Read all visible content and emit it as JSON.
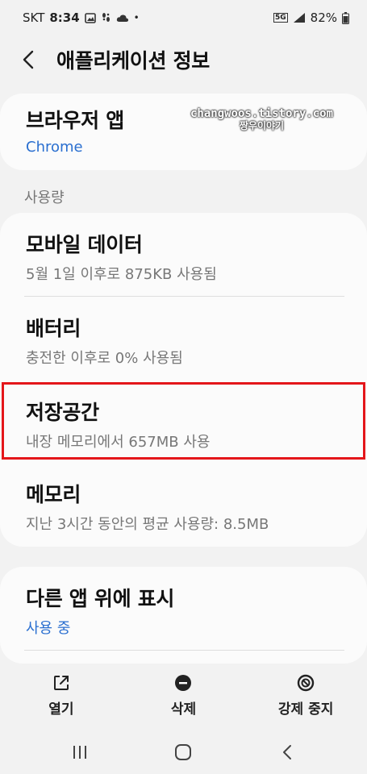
{
  "status_bar": {
    "carrier": "SKT",
    "time": "8:34",
    "dot": "•",
    "network": "5G",
    "battery": "82%"
  },
  "header": {
    "title": "애플리케이션 정보",
    "back_icon": "chevron-left-icon"
  },
  "app_card": {
    "name": "브라우저 앱",
    "app": "Chrome"
  },
  "watermark": {
    "line1": "changwoos.tistory.com",
    "line2": "짱우이야기"
  },
  "usage": {
    "section_label": "사용량",
    "items": [
      {
        "title": "모바일 데이터",
        "subtitle": "5월 1일 이후로 875KB 사용됨"
      },
      {
        "title": "배터리",
        "subtitle": "충전한 이후로 0% 사용됨"
      },
      {
        "title": "저장공간",
        "subtitle": "내장 메모리에서 657MB 사용"
      },
      {
        "title": "메모리",
        "subtitle": "지난 3시간 동안의 평균 사용량: 8.5MB"
      }
    ]
  },
  "overlay_card": {
    "title": "다른 앱 위에 표시",
    "status": "사용 중"
  },
  "bottom_actions": [
    {
      "label": "열기",
      "icon": "open-external-icon"
    },
    {
      "label": "삭제",
      "icon": "minus-circle-icon"
    },
    {
      "label": "강제 중지",
      "icon": "block-icon"
    }
  ],
  "nav": {
    "recents": "recents-icon",
    "home": "home-icon",
    "back": "back-icon"
  },
  "colors": {
    "accent_blue": "#2a6fd0",
    "highlight_red": "#e4161a",
    "background": "#f2f2f2"
  }
}
